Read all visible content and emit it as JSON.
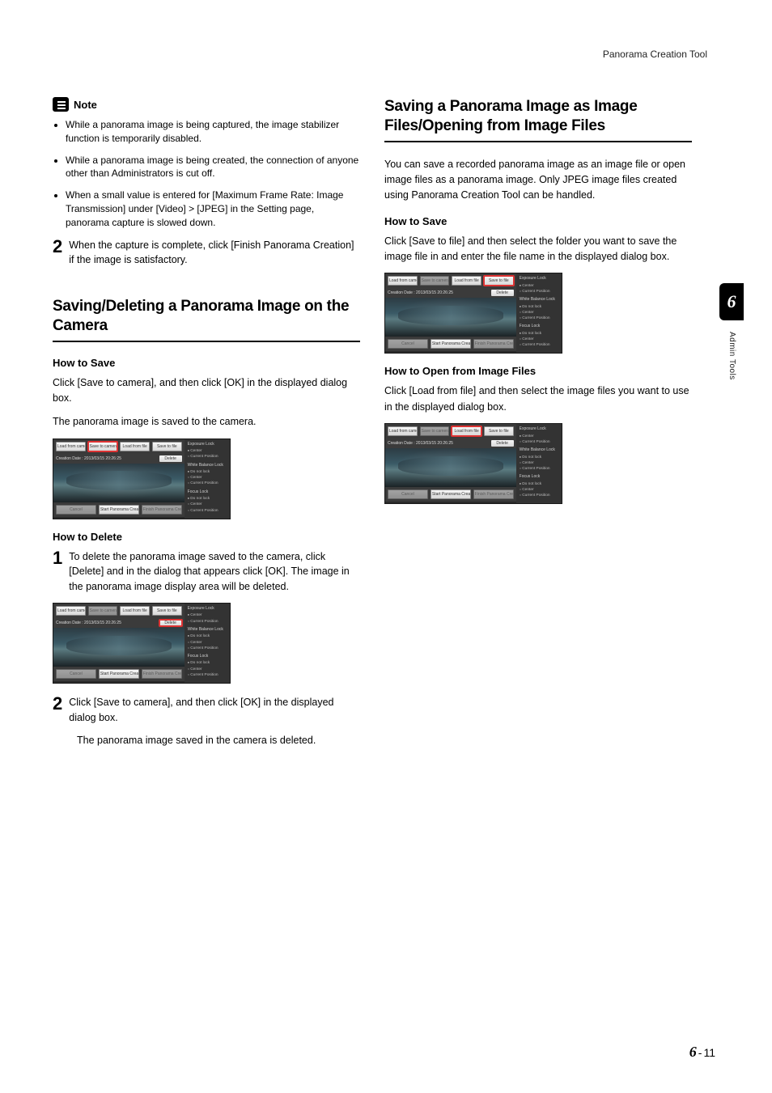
{
  "header": {
    "tool_name": "Panorama Creation Tool"
  },
  "note": {
    "label": "Note",
    "items": [
      "While a panorama image is being captured, the image stabilizer function is temporarily disabled.",
      "While a panorama image is being created, the connection of anyone other than Administrators is cut off.",
      "When a small value is entered for [Maximum Frame Rate: Image Transmission] under [Video] > [JPEG] in the Setting page, panorama capture is slowed down."
    ]
  },
  "step2a": {
    "num": "2",
    "text": "When the capture is complete, click [Finish Panorama Creation] if the image is satisfactory."
  },
  "sectionA": {
    "title": "Saving/Deleting a Panorama Image on the Camera",
    "save_head": "How to Save",
    "save_p1": "Click [Save to camera], and then click [OK] in the displayed dialog box.",
    "save_p2": "The panorama image is saved to the camera.",
    "del_head": "How to Delete",
    "del_step1": {
      "num": "1",
      "text": "To delete the panorama image saved to the camera, click [Delete] and in the dialog that appears click [OK]. The image in the panorama image display area will be deleted."
    },
    "del_step2": {
      "num": "2",
      "text": "Click [Save to camera], and then click [OK] in the displayed dialog box."
    },
    "del_sub": "The panorama image saved in the camera is deleted."
  },
  "sectionB": {
    "title": "Saving a Panorama Image as Image Files/Opening from Image Files",
    "intro": "You can save a recorded panorama image as an image file or open image files as a panorama image. Only JPEG image files created using Panorama Creation Tool can be handled.",
    "save_head": "How to Save",
    "save_p": "Click [Save to file] and then select the folder you want to save the image file in and enter the file name in the displayed dialog box.",
    "open_head": "How to Open from Image Files",
    "open_p": "Click [Load from file] and then select the image files you want to use in the displayed dialog box."
  },
  "shot": {
    "btn_load_cam": "Load from camera",
    "btn_save_cam": "Save to camera",
    "btn_load_file": "Load from file",
    "btn_save_file": "Save to file",
    "date": "Creation Date : 2013/03/15 20:26:25",
    "btn_delete": "Delete",
    "btn_cancel": "Cancel",
    "btn_start": "Start Panorama Creation",
    "btn_finish": "Finish Panorama Creation",
    "grp1": "Exposure Lock",
    "grp2": "White Balance Lock",
    "grp3": "Focus Lock",
    "o_center": "Center",
    "o_curpos": "Current Position",
    "o_nolock": "Do not lock"
  },
  "sidebar": {
    "chapter": "6",
    "label": "Admin Tools"
  },
  "footer": {
    "chapter": "6",
    "sep": "-",
    "page": "11"
  }
}
